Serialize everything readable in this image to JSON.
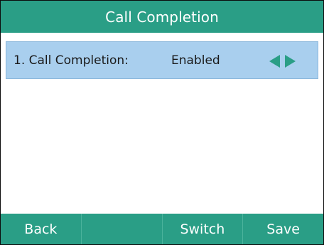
{
  "title": "Call Completion",
  "item": {
    "label": "1. Call Completion:",
    "value": "Enabled",
    "left_arrow_icon": "triangle-left",
    "right_arrow_icon": "triangle-right"
  },
  "softkeys": [
    "Back",
    "",
    "Switch",
    "Save"
  ],
  "colors": {
    "accent": "#2a9e86",
    "selection": "#a9cfee",
    "text": "#1a1a1a"
  }
}
